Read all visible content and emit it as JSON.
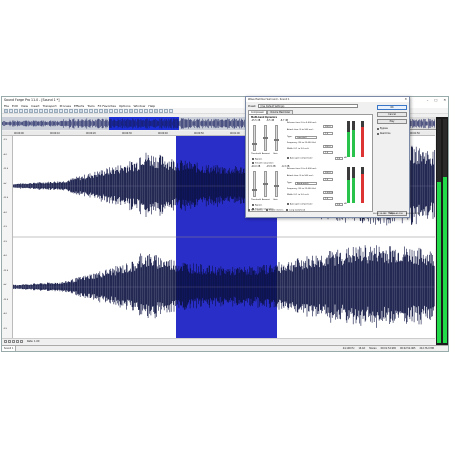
{
  "window": {
    "title": "Sound Forge Pro 11.0 - [Sound 1 *]",
    "minimize": "–",
    "maximize": "□",
    "close": "✕"
  },
  "menu": [
    "File",
    "Edit",
    "View",
    "Insert",
    "Transport",
    "Process",
    "Effects",
    "Tools",
    "FX Favorites",
    "Options",
    "Window",
    "Help"
  ],
  "ruler": [
    "00:00:00",
    "00:00:10",
    "00:00:20",
    "00:00:30",
    "00:00:40",
    "00:00:50",
    "00:01:00",
    "00:01:10",
    "00:01:20",
    "00:01:30",
    "00:01:40",
    "00:01:50"
  ],
  "yaxis": [
    "-2.5",
    "-6.0",
    "-12.0",
    "-Inf",
    "-12.0",
    "-6.0",
    "-2.5",
    "-2.5",
    "-6.0",
    "-12.0",
    "-Inf",
    "-12.0",
    "-6.0",
    "-2.5"
  ],
  "transport": {
    "zoom": "Rate: 1.00"
  },
  "status": {
    "doc_tab": "Sound 1",
    "values": [
      "44,100 Hz",
      "16 bit",
      "Stereo",
      "00:01:52.965",
      "00:02:52.965",
      "20,176.0 MB"
    ]
  },
  "vu": {
    "left": 0.72,
    "right": 0.74
  },
  "dialog": {
    "title": "Wave Hammer Surround - Sound 1",
    "close": "✕",
    "preset_label": "Preset:",
    "preset_value": "(Use Default Settings)",
    "tabs": [
      "Compressor",
      "Volume Maximizer"
    ],
    "panel_title": "Multi-band Dynamics",
    "band1": {
      "hdr": [
        "-15.5 dB",
        "-8.5 dB",
        "-8.7 dB"
      ],
      "threshold": "Threshold",
      "amount": "Amount",
      "gain": "Gain",
      "release": "Release time (0 to 5,000 ms):",
      "release_val": "200.0",
      "attack": "Attack time (0 to 500 ms):",
      "attack_val": "1.0",
      "type_label": "Type:",
      "type_val": "Low-shelf",
      "freq": "Frequency (20 to 22,050 Hz):",
      "freq_val": "200.0",
      "width": "Width (0.1 to 3.0 oct):",
      "width_val": "1.0",
      "gain_val": "0.0",
      "db": "dB",
      "knee": "Auto gain compensate",
      "bypass": "Bypass",
      "smooth": "Smooth saturation"
    },
    "band2": {
      "hdr": [
        "-20.0 dB",
        "-15.5 dB",
        "-6.3 dB"
      ],
      "threshold": "Threshold",
      "amount": "Amount",
      "gain": "Gain",
      "release": "Release time (0 to 5,000 ms):",
      "release_val": "200.0",
      "attack": "Attack time (0 to 500 ms):",
      "attack_val": "1.0",
      "type_label": "Type:",
      "type_val": "Band-notch",
      "freq": "Frequency (20 to 22,050 Hz):",
      "freq_val": "2,000.0",
      "width": "Width (0.1 to 3.0 oct):",
      "width_val": "1.0",
      "gain_val": "0.0",
      "db": "dB",
      "knee": "Auto gain compensate",
      "bypass": "Bypass",
      "smooth": "Smooth saturation"
    },
    "side": {
      "ok": "OK",
      "cancel": "Cancel",
      "preview": "Play",
      "bypass": "Bypass",
      "realtime": "Real-time",
      "help": "Help..."
    },
    "bottom": [
      "Sync stereo",
      "Enable meters",
      "Long lookahead"
    ],
    "timecodes": [
      "00:00:14.488",
      "00:00:45.990",
      "00:01:02.970"
    ],
    "meters": {
      "l1": 0.7,
      "r1": 0.75,
      "l2": 0.65,
      "r2": 0.7,
      "o1": 0.82,
      "o2": 0.8
    }
  }
}
